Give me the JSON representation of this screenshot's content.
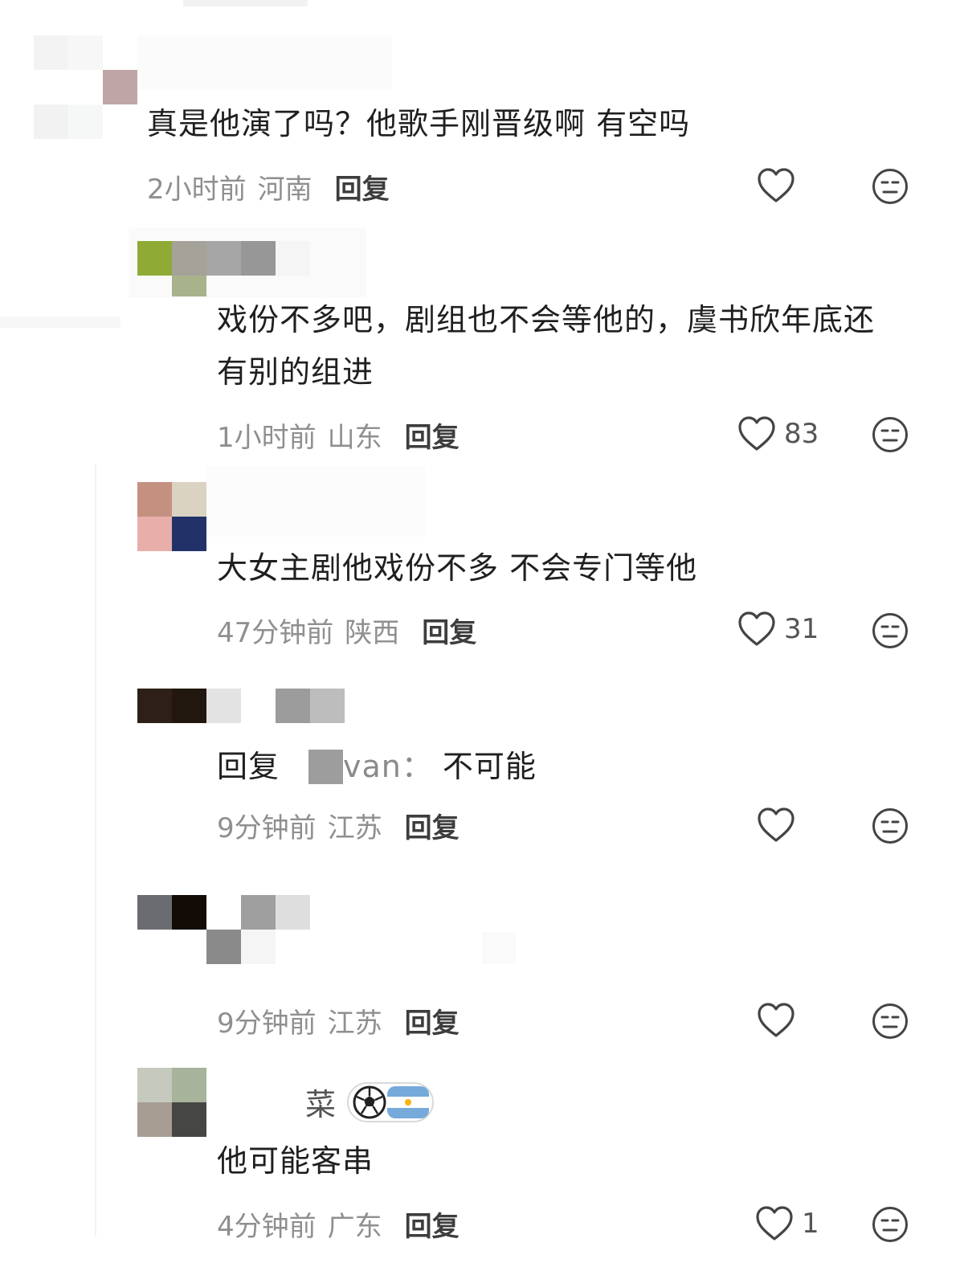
{
  "colors": {
    "text": "#1f1f1f",
    "meta": "#8f8f8f",
    "icon": "#444444"
  },
  "comments": [
    {
      "text": "真是他演了吗？他歌手刚晋级啊 有空吗",
      "time": "2小时前",
      "location": "河南",
      "reply_label": "回复",
      "likes": ""
    },
    {
      "text_line1": "戏份不多吧，剧组也不会等他的，虞书欣年底还",
      "text_line2": "有别的组进",
      "time": "1小时前",
      "location": "山东",
      "reply_label": "回复",
      "likes": "83"
    },
    {
      "text": "大女主剧他戏份不多 不会专门等他",
      "time": "47分钟前",
      "location": "陕西",
      "reply_label": "回复",
      "likes": "31"
    },
    {
      "reply_prefix": "回复",
      "reply_to_fragment": "van：",
      "text": "不可能",
      "time": "9分钟前",
      "location": "江苏",
      "reply_label": "回复",
      "likes": ""
    },
    {
      "time": "9分钟前",
      "location": "江苏",
      "reply_label": "回复",
      "likes": ""
    },
    {
      "username_fragment": "菜",
      "badge_icons": [
        "soccer-ball-icon",
        "argentina-flag-icon"
      ],
      "text": "他可能客串",
      "time": "4分钟前",
      "location": "广东",
      "reply_label": "回复",
      "likes": "1"
    }
  ]
}
